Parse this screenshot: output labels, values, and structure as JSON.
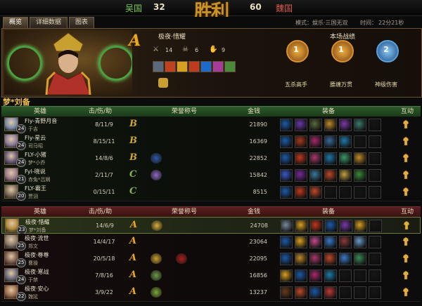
{
  "scoreboard": {
    "team_left": "吴国",
    "score_left": "32",
    "result": "胜利",
    "score_right": "60",
    "team_right": "魏国"
  },
  "tabs": [
    "概览",
    "详细数据",
    "图表"
  ],
  "match_info": {
    "mode_label": "模式：娱乐·三国无双",
    "time_label": "时间：",
    "time_value": "22分21秒"
  },
  "hero_panel": {
    "grade": "A",
    "player_name": "极夜·惜耀",
    "stat_kills": "14",
    "stat_deaths": "6",
    "stat_assists": "9",
    "battle_title": "本场战绩",
    "medals": [
      {
        "num": "1",
        "label": "五杀高手",
        "color": "#d08a2a"
      },
      {
        "num": "1",
        "label": "腰缠万贯",
        "color": "#d08a2a"
      },
      {
        "num": "2",
        "label": "神级伤害",
        "color": "#5aa0d8"
      }
    ]
  },
  "hero_title": "梦*刘备",
  "columns": {
    "hero": "英雄",
    "kda": "击/伤/助",
    "honor": "荣誉称号",
    "gold": "金钱",
    "equip": "装备",
    "interact": "互动"
  },
  "team_green": [
    {
      "name": "Fly-青野月音",
      "level": "24",
      "alias": "于吉",
      "kda": "8/11/9",
      "grade": "B",
      "gold": "21890",
      "avatar_color": "#7a8aa8",
      "honors": [],
      "equip": [
        "#1e5aa8",
        "#6a3aa8",
        "#5a6a3a",
        "#c08a2a",
        "#7a3aa8",
        "#3a7a6a",
        "#151515"
      ]
    },
    {
      "name": "Fly-星云",
      "level": "24",
      "alias": "司马昭",
      "kda": "8/15/11",
      "grade": "B",
      "gold": "16369",
      "avatar_color": "#8a7a9a",
      "honors": [],
      "equip": [
        "#1e5aa8",
        "#a83a1e",
        "#a82a6a",
        "#3a6a9a",
        "#1e7aa8",
        "#151515",
        "#151515"
      ]
    },
    {
      "name": "FLY-小猪",
      "level": "24",
      "alias": "梦*小乔",
      "kda": "14/8/6",
      "grade": "B",
      "gold": "22852",
      "avatar_color": "#6a5a7a",
      "honors": [
        "#2a5aa8"
      ],
      "equip": [
        "#1e5aa8",
        "#c03a1e",
        "#a83a6a",
        "#1e7aa8",
        "#3a9a6a",
        "#c08a2a",
        "#151515"
      ]
    },
    {
      "name": "Fyl-晓说",
      "level": "21",
      "alias": "赤兔*吕娴",
      "kda": "2/11/7",
      "grade": "C",
      "gold": "15842",
      "avatar_color": "#9a7a8a",
      "honors": [
        "#8a6ac8"
      ],
      "equip": [
        "#3a5ac8",
        "#7a2a9a",
        "#3a7a9a",
        "#c04a2a",
        "#c0a040",
        "#3a8a3a",
        "#151515"
      ]
    },
    {
      "name": "FLY-霸王",
      "level": "20",
      "alias": "贾诩",
      "kda": "0/15/11",
      "grade": "C",
      "gold": "8515",
      "avatar_color": "#7a6a5a",
      "honors": [],
      "equip": [
        "#1e5aa8",
        "#c03a1e",
        "#c04a2a",
        "#151515",
        "#151515",
        "#151515",
        "#151515"
      ]
    }
  ],
  "team_red": [
    {
      "name": "极夜·惜耀",
      "level": "23",
      "alias": "梦*刘备",
      "kda": "14/6/9",
      "grade": "A",
      "gold": "24708",
      "selected": true,
      "avatar_color": "#b08a3a",
      "honors": [
        "#d8b040"
      ],
      "equip": [
        "#7a8a9a",
        "#d8a020",
        "#c03a1e",
        "#1e5aa8",
        "#7a3aa8",
        "#d8a020",
        "#151515"
      ]
    },
    {
      "name": "极夜·流世",
      "level": "25",
      "alias": "郑文",
      "kda": "14/4/17",
      "grade": "A",
      "gold": "23064",
      "avatar_color": "#8a7a6a",
      "honors": [],
      "equip": [
        "#1e5aa8",
        "#d8a020",
        "#c04a8a",
        "#3a7ac8",
        "#8a3a3a",
        "#6a9ac8",
        "#151515"
      ]
    },
    {
      "name": "极夜·尊尊",
      "level": "25",
      "alias": "曹操",
      "kda": "20/5/18",
      "grade": "A",
      "gold": "22095",
      "avatar_color": "#7a5a4a",
      "honors": [
        "#c8a030",
        "#a82020"
      ],
      "equip": [
        "#1e5aa8",
        "#c08a2a",
        "#a83a6a",
        "#c04a2a",
        "#3a7ac8",
        "#3a8a5a",
        "#151515"
      ]
    },
    {
      "name": "极夜·寒战",
      "level": "24",
      "alias": "于禁",
      "kda": "7/8/16",
      "grade": "A",
      "gold": "16856",
      "avatar_color": "#6a6a7a",
      "honors": [
        "#6a9a4a"
      ],
      "equip": [
        "#d8a020",
        "#1e5aa8",
        "#a82a6a",
        "#1e7aa8",
        "#151515",
        "#151515",
        "#151515"
      ]
    },
    {
      "name": "极夜·安心",
      "level": "22",
      "alias": "魏延",
      "kda": "3/9/22",
      "grade": "A",
      "gold": "13237",
      "avatar_color": "#9a6a4a",
      "honors": [
        "#7aa83a"
      ],
      "equip": [
        "#6a3a1e",
        "#c04a2a",
        "#1e5aa8",
        "#c03a3a",
        "#151515",
        "#151515",
        "#151515"
      ]
    }
  ],
  "icons": {
    "interact": "pray-icon",
    "close": "close-icon"
  }
}
